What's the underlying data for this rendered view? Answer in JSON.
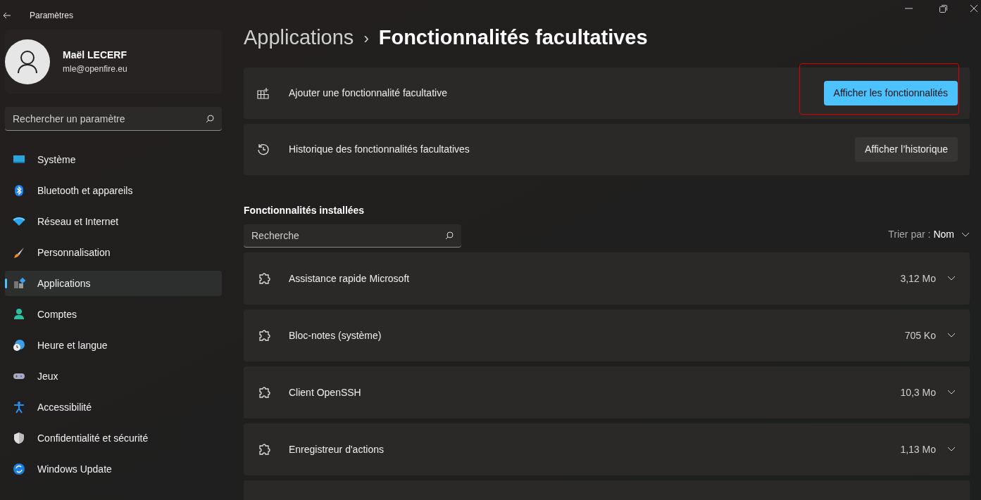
{
  "window": {
    "title": "Paramètres"
  },
  "user": {
    "name": "Maël LECERF",
    "email": "mle@openfire.eu"
  },
  "sidebar": {
    "search": {
      "placeholder": "Rechercher un paramètre"
    },
    "items": [
      {
        "label": "Système",
        "selected": false
      },
      {
        "label": "Bluetooth et appareils",
        "selected": false
      },
      {
        "label": "Réseau et Internet",
        "selected": false
      },
      {
        "label": "Personnalisation",
        "selected": false
      },
      {
        "label": "Applications",
        "selected": true
      },
      {
        "label": "Comptes",
        "selected": false
      },
      {
        "label": "Heure et langue",
        "selected": false
      },
      {
        "label": "Jeux",
        "selected": false
      },
      {
        "label": "Accessibilité",
        "selected": false
      },
      {
        "label": "Confidentialité et sécurité",
        "selected": false
      },
      {
        "label": "Windows Update",
        "selected": false
      }
    ]
  },
  "breadcrumb": {
    "parent": "Applications",
    "separator": "›",
    "current": "Fonctionnalités facultatives"
  },
  "action_cards": [
    {
      "kind": "add",
      "label": "Ajouter une fonctionnalité facultative",
      "button": "Afficher les fonctionnalités",
      "primary": true,
      "highlighted": true
    },
    {
      "kind": "history",
      "label": "Historique des fonctionnalités facultatives",
      "button": "Afficher l’historique",
      "primary": false,
      "highlighted": false
    }
  ],
  "installed": {
    "heading": "Fonctionnalités installées",
    "search": {
      "placeholder": "Recherche"
    },
    "sort": {
      "label": "Trier par :",
      "value": "Nom"
    },
    "features": [
      {
        "name": "Assistance rapide Microsoft",
        "size": "3,12 Mo"
      },
      {
        "name": "Bloc-notes (système)",
        "size": "705 Ko"
      },
      {
        "name": "Client OpenSSH",
        "size": "10,3 Mo"
      },
      {
        "name": "Enregistreur d'actions",
        "size": "1,13 Mo"
      }
    ]
  }
}
